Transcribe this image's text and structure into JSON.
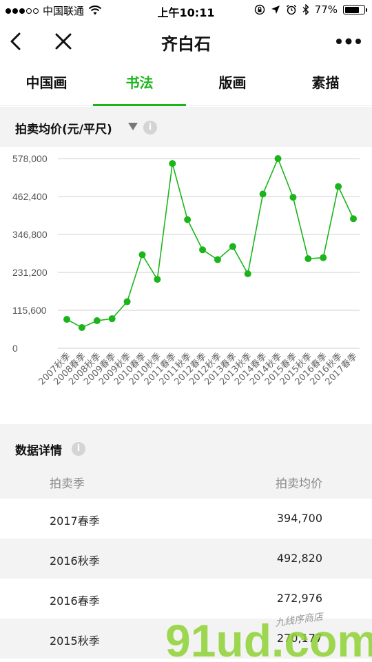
{
  "status_bar": {
    "carrier": "中国联通",
    "time": "上午10:11",
    "battery": "77%",
    "battery_level": 0.77
  },
  "nav": {
    "title": "齐白石",
    "back_icon": "chevron-left-icon",
    "close_icon": "close-icon",
    "more_icon": "more-icon"
  },
  "tabs": [
    {
      "label": "中国画",
      "active": false
    },
    {
      "label": "书法",
      "active": true
    },
    {
      "label": "版画",
      "active": false
    },
    {
      "label": "素描",
      "active": false
    }
  ],
  "chart_section": {
    "label": "拍卖均价(元/平尺)",
    "info": "i"
  },
  "chart_data": {
    "type": "line",
    "categories": [
      "2007秋季",
      "2008春季",
      "2008秋季",
      "2009春季",
      "2009秋季",
      "2010春季",
      "2010秋季",
      "2011春季",
      "2011秋季",
      "2012春季",
      "2012秋季",
      "2013春季",
      "2013秋季",
      "2014春季",
      "2014秋季",
      "2015春季",
      "2015秋季",
      "2016春季",
      "2016秋季",
      "2017春季"
    ],
    "values": [
      88000,
      63000,
      84000,
      90000,
      142000,
      285000,
      210000,
      563000,
      392000,
      300000,
      270000,
      310000,
      227000,
      470000,
      578000,
      460000,
      273000,
      276000,
      492820,
      394700
    ],
    "yticks": [
      "0",
      "115,600",
      "231,200",
      "346,800",
      "462,400",
      "578,000"
    ],
    "ylim": [
      0,
      578000
    ],
    "color": "#1bb51b",
    "grid": true
  },
  "details": {
    "label": "数据详情",
    "info": "i",
    "col_season": "拍卖季",
    "col_price": "拍卖均价",
    "rows": [
      {
        "season": "2017春季",
        "price": "394,700"
      },
      {
        "season": "2016秋季",
        "price": "492,820"
      },
      {
        "season": "2016春季",
        "price": "272,976"
      },
      {
        "season": "2015秋季",
        "price": "270,177"
      }
    ]
  },
  "watermark": {
    "text": "91ud.com",
    "sub": "九线序商店",
    "colors": [
      "#b3e03a",
      "#7fcf2b",
      "#3dbf6b"
    ]
  }
}
